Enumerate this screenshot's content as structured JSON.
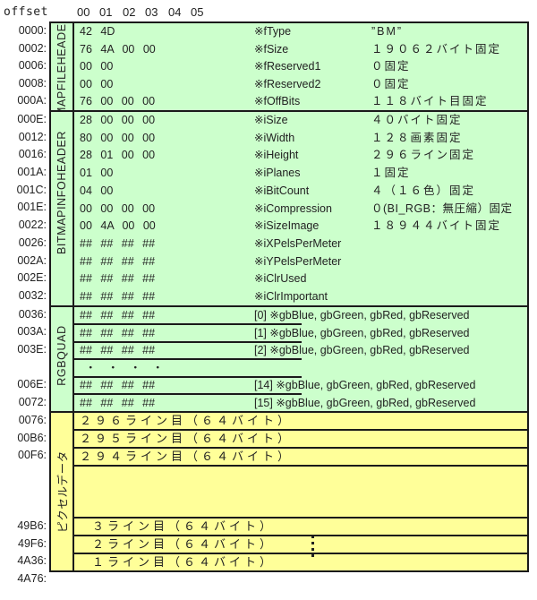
{
  "header": {
    "offset_label": "offset",
    "columns": [
      "00",
      "01",
      "02",
      "03",
      "04",
      "05"
    ]
  },
  "sections": {
    "file_header": {
      "label": "BITMAPFILEHEADER",
      "color": "#ccffcc",
      "rows": [
        {
          "offset": "0000:",
          "hex": "42 4D",
          "field": "※fType",
          "desc": "”BM”"
        },
        {
          "offset": "0002:",
          "hex": "76 4A 00 00",
          "field": "※fSize",
          "desc": "１９０６２バイト固定"
        },
        {
          "offset": "0006:",
          "hex": "00 00",
          "field": "※fReserved1",
          "desc": "０固定"
        },
        {
          "offset": "0008:",
          "hex": "00 00",
          "field": "※fReserved2",
          "desc": "０固定"
        },
        {
          "offset": "000A:",
          "hex": "76 00 00 00",
          "field": "※fOffBits",
          "desc": "１１８バイト目固定"
        }
      ]
    },
    "info_header": {
      "label": "BITMAPINFOHEADER",
      "color": "#ccffcc",
      "rows": [
        {
          "offset": "000E:",
          "hex": "28 00 00 00",
          "field": "※iSize",
          "desc": "４０バイト固定"
        },
        {
          "offset": "0012:",
          "hex": "80 00 00 00",
          "field": "※iWidth",
          "desc": "１２８画素固定"
        },
        {
          "offset": "0016:",
          "hex": "28 01 00 00",
          "field": "※iHeight",
          "desc": "２９６ライン固定"
        },
        {
          "offset": "001A:",
          "hex": "01 00",
          "field": "※iPlanes",
          "desc": "１固定"
        },
        {
          "offset": "001C:",
          "hex": "04 00",
          "field": "※iBitCount",
          "desc": "４（１６色）固定"
        },
        {
          "offset": "001E:",
          "hex": "00 00 00 00",
          "field": "※iCompression",
          "desc": "０(BI_RGB：無圧縮）固定"
        },
        {
          "offset": "0022:",
          "hex": "00 4A 00 00",
          "field": "※iSizeImage",
          "desc": "１８９４４バイト固定"
        },
        {
          "offset": "0026:",
          "hex": "## ## ## ##",
          "field": "※iXPelsPerMeter",
          "desc": ""
        },
        {
          "offset": "002A:",
          "hex": "## ## ## ##",
          "field": "※iYPelsPerMeter",
          "desc": ""
        },
        {
          "offset": "002E:",
          "hex": "## ## ## ##",
          "field": "※iClrUsed",
          "desc": ""
        },
        {
          "offset": "0032:",
          "hex": "## ## ## ##",
          "field": "※iClrImportant",
          "desc": ""
        }
      ]
    },
    "rgbquad": {
      "label": "RGBQUAD",
      "color": "#ccffcc",
      "ellipsis": "・　・　・　・",
      "rows": [
        {
          "offset": "0036:",
          "hex": "## ## ## ##",
          "index": "[0] ※gbBlue, gbGreen, gbRed, gbReserved"
        },
        {
          "offset": "003A:",
          "hex": "## ## ## ##",
          "index": "[1] ※gbBlue, gbGreen, gbRed, gbReserved"
        },
        {
          "offset": "003E:",
          "hex": "## ## ## ##",
          "index": "[2] ※gbBlue, gbGreen, gbRed, gbReserved"
        },
        {
          "offset": "006E:",
          "hex": "## ## ## ##",
          "index": "[14] ※gbBlue, gbGreen, gbRed, gbReserved"
        },
        {
          "offset": "0072:",
          "hex": "## ## ## ##",
          "index": "[15] ※gbBlue, gbGreen, gbRed, gbReserved"
        }
      ]
    },
    "pixel_data": {
      "label": "ピクセルデータ",
      "color": "#ffff99",
      "rows": [
        {
          "offset": "0076:",
          "text": "２９６ライン目（６４バイト）"
        },
        {
          "offset": "00B6:",
          "text": "２９５ライン目（６４バイト）"
        },
        {
          "offset": "00F6:",
          "text": "２９４ライン目（６４バイト）"
        },
        {
          "offset": "49B6:",
          "text": "３ライン目（６４バイト）"
        },
        {
          "offset": "49F6:",
          "text": "２ライン目（６４バイト）"
        },
        {
          "offset": "4A36:",
          "text": "１ライン目（６４バイト）"
        }
      ],
      "end_offset": "4A76:"
    }
  }
}
